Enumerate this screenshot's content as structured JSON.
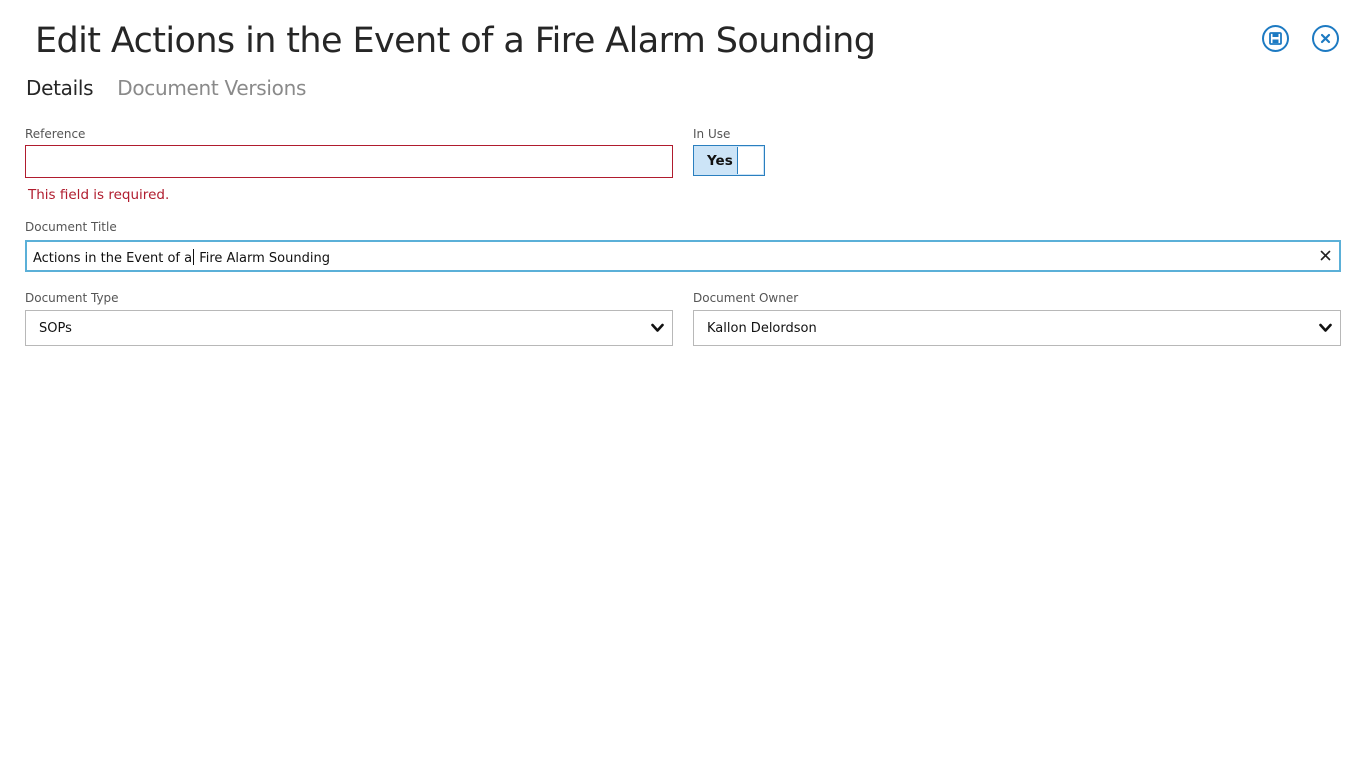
{
  "header": {
    "title": "Edit Actions in the Event of a Fire Alarm Sounding",
    "save_icon": "save-icon",
    "close_icon": "close-icon",
    "accent_color": "#1d7ac2"
  },
  "tabs": [
    {
      "label": "Details",
      "active": true
    },
    {
      "label": "Document Versions",
      "active": false
    }
  ],
  "form": {
    "reference": {
      "label": "Reference",
      "value": "",
      "error": "This field is required."
    },
    "in_use": {
      "label": "In Use",
      "value": "Yes"
    },
    "document_title": {
      "label": "Document Title",
      "value_before_caret": "Actions in the Event of a",
      "value_after_caret": " Fire Alarm Sounding",
      "clear_icon": "close-icon"
    },
    "document_type": {
      "label": "Document Type",
      "value": "SOPs",
      "icon": "chevron-down-icon"
    },
    "document_owner": {
      "label": "Document Owner",
      "value": "Kallon Delordson",
      "icon": "chevron-down-icon"
    }
  },
  "colors": {
    "error": "#b01c2e",
    "focus_border": "#5bb0d8",
    "toggle_bg": "#cce4f7"
  }
}
